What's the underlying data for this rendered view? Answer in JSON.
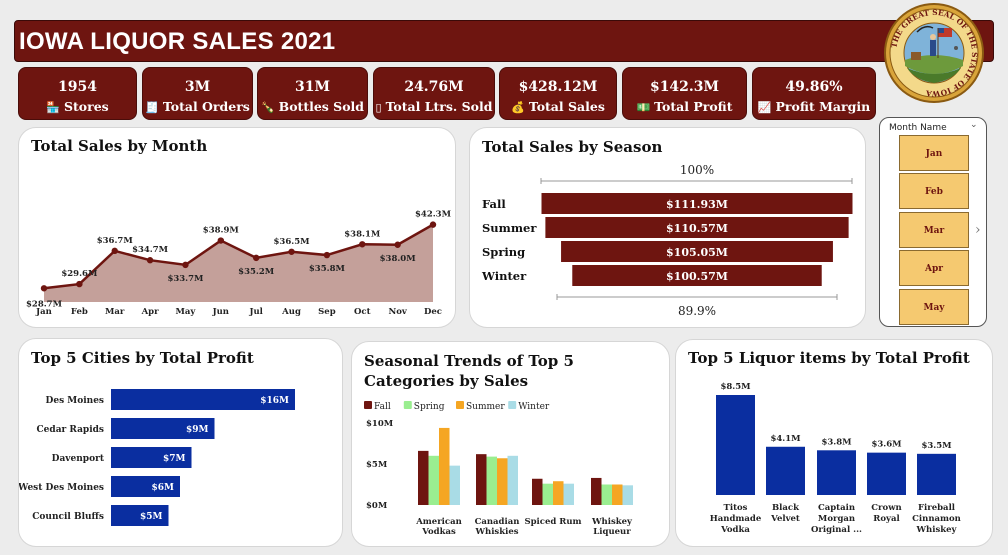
{
  "title": "IOWA LIQUOR SALES 2021",
  "seal_text": "THE GREAT SEAL OF THE STATE OF IOWA",
  "kpis": [
    {
      "value": "1954",
      "label": "Stores",
      "icon": "store-icon",
      "glyph": "🏪"
    },
    {
      "value": "3M",
      "label": "Total Orders",
      "icon": "receipt-icon",
      "glyph": "🧾"
    },
    {
      "value": "31M",
      "label": "Bottles Sold",
      "icon": "bottle-icon",
      "glyph": "🍾"
    },
    {
      "value": "24.76M",
      "label": "Total Ltrs. Sold",
      "icon": "container-icon",
      "glyph": "▯"
    },
    {
      "value": "$428.12M",
      "label": "Total Sales",
      "icon": "money-bag-icon",
      "glyph": "💰"
    },
    {
      "value": "$142.3M",
      "label": "Total Profit",
      "icon": "cash-icon",
      "glyph": "💵"
    },
    {
      "value": "49.86%",
      "label": "Profit Margin",
      "icon": "chart-up-icon",
      "glyph": "📈"
    }
  ],
  "slicer": {
    "header": "Month Name",
    "items": [
      "Jan",
      "Feb",
      "Mar",
      "Apr",
      "May"
    ]
  },
  "chart_data": [
    {
      "type": "area",
      "title": "Total Sales by Month",
      "categories": [
        "Jan",
        "Feb",
        "Mar",
        "Apr",
        "May",
        "Jun",
        "Jul",
        "Aug",
        "Sep",
        "Oct",
        "Nov",
        "Dec"
      ],
      "values": [
        28.7,
        29.6,
        36.7,
        34.7,
        33.7,
        38.9,
        35.2,
        36.5,
        35.8,
        38.1,
        38.0,
        42.3
      ],
      "labels": [
        "$28.7M",
        "$29.6M",
        "$36.7M",
        "$34.7M",
        "$33.7M",
        "$38.9M",
        "$35.2M",
        "$36.5M",
        "$35.8M",
        "$38.1M",
        "$38.0M",
        "$42.3M"
      ],
      "colors": {
        "line": "#6e1510",
        "fill": "#c4a09a"
      }
    },
    {
      "type": "bar",
      "subtype": "funnel",
      "title": "Total Sales by Season",
      "categories": [
        "Fall",
        "Summer",
        "Spring",
        "Winter"
      ],
      "values": [
        111.93,
        110.57,
        105.05,
        100.57
      ],
      "labels": [
        "$111.93M",
        "$110.57M",
        "$105.05M",
        "$100.57M"
      ],
      "top_label": "100%",
      "bottom_label": "89.9%",
      "color": "#6e1510"
    },
    {
      "type": "bar",
      "orientation": "horizontal",
      "title": "Top 5 Cities by Total Profit",
      "categories": [
        "Des Moines",
        "Cedar Rapids",
        "Davenport",
        "West Des Moines",
        "Council Bluffs"
      ],
      "values": [
        16,
        9,
        7,
        6,
        5
      ],
      "labels": [
        "$16M",
        "$9M",
        "$7M",
        "$6M",
        "$5M"
      ],
      "color": "#0a2ea0"
    },
    {
      "type": "bar",
      "title": "Seasonal Trends of Top 5 Categories by Sales",
      "categories": [
        [
          "American",
          "Vodkas"
        ],
        [
          "Canadian",
          "Whiskies"
        ],
        [
          "Spiced Rum"
        ],
        [
          "Whiskey",
          "Liqueur"
        ]
      ],
      "series": [
        {
          "name": "Fall",
          "color": "#6e1510",
          "values": [
            6.6,
            6.2,
            3.2,
            3.3
          ]
        },
        {
          "name": "Spring",
          "color": "#9aee90",
          "values": [
            6.0,
            5.9,
            2.6,
            2.5
          ]
        },
        {
          "name": "Summer",
          "color": "#f5a623",
          "values": [
            9.4,
            5.7,
            2.9,
            2.5
          ]
        },
        {
          "name": "Winter",
          "color": "#a9dce6",
          "values": [
            4.8,
            6.0,
            2.6,
            2.4
          ]
        }
      ],
      "yticks": [
        "$0M",
        "$5M",
        "$10M"
      ],
      "ylim": [
        0,
        10
      ]
    },
    {
      "type": "bar",
      "title": "Top 5 Liquor items by Total Profit",
      "categories": [
        [
          "Titos",
          "Handmade",
          "Vodka"
        ],
        [
          "Black",
          "Velvet"
        ],
        [
          "Captain",
          "Morgan",
          "Original ..."
        ],
        [
          "Crown",
          "Royal"
        ],
        [
          "Fireball",
          "Cinnamon",
          "Whiskey"
        ]
      ],
      "values": [
        8.5,
        4.1,
        3.8,
        3.6,
        3.5
      ],
      "labels": [
        "$8.5M",
        "$4.1M",
        "$3.8M",
        "$3.6M",
        "$3.5M"
      ],
      "color": "#0a2ea0"
    }
  ]
}
